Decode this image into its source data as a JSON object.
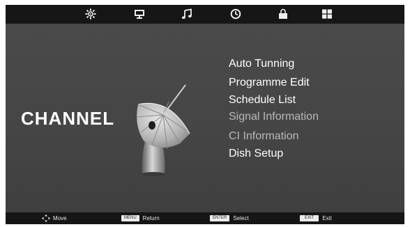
{
  "colors": {
    "accent": "#ffffff",
    "dimmed": "#b9b9b9",
    "background": "#454545",
    "bar": "#161616"
  },
  "top_tabs": [
    {
      "icon": "picture-settings-icon"
    },
    {
      "icon": "monitor-icon"
    },
    {
      "icon": "music-note-icon"
    },
    {
      "icon": "clock-icon"
    },
    {
      "icon": "lock-icon"
    },
    {
      "icon": "grid-icon"
    }
  ],
  "page": {
    "title": "CHANNEL",
    "illustration_icon": "satellite-dish-icon"
  },
  "menu": {
    "items": [
      {
        "label": "Auto Tunning",
        "enabled": true
      },
      {
        "label": "Programme Edit",
        "enabled": true
      },
      {
        "label": "Schedule List",
        "enabled": true
      },
      {
        "label": "Signal Information",
        "enabled": false
      },
      {
        "label": "CI Information",
        "enabled": false
      },
      {
        "label": "Dish Setup",
        "enabled": true
      }
    ]
  },
  "footer": {
    "move": {
      "icon": "move-arrows-icon",
      "label": "Move"
    },
    "return": {
      "key": "MENU",
      "label": "Return"
    },
    "select": {
      "key": "ENTER",
      "label": "Select"
    },
    "exit": {
      "key": "EXIT",
      "label": "Exit"
    }
  }
}
